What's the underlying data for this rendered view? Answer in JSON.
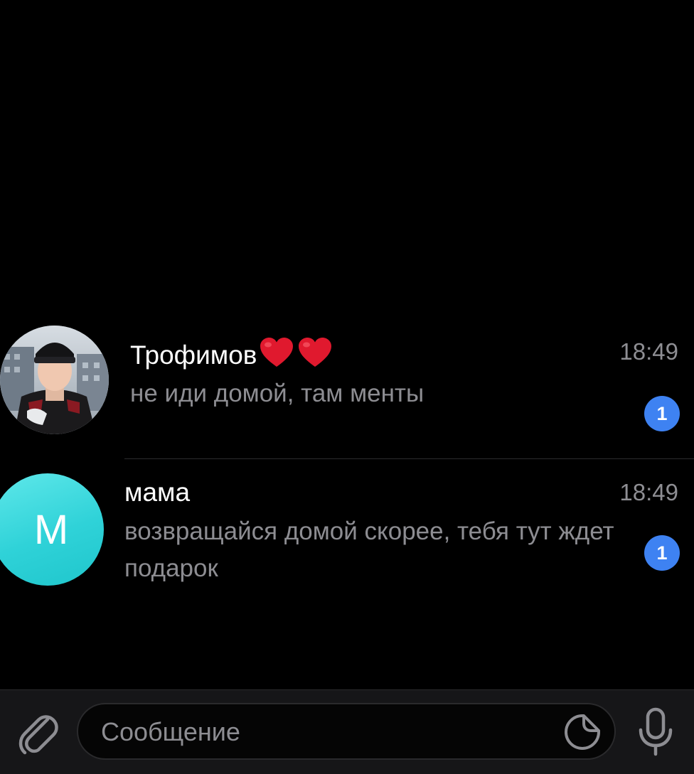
{
  "chats": [
    {
      "name": "Трофимов",
      "name_emoji": "❤️❤️",
      "time": "18:49",
      "preview": "не иди домой, там менты",
      "unread_count": "1",
      "avatar": "photo"
    },
    {
      "name": "мама",
      "time": "18:49",
      "preview": "возвращайся домой скорее, тебя тут ждет подарок",
      "unread_count": "1",
      "avatar_letter": "М"
    }
  ],
  "composer": {
    "placeholder": "Сообщение",
    "attach_icon": "paperclip-icon",
    "sticker_icon": "sticker-icon",
    "mic_icon": "microphone-icon"
  },
  "colors": {
    "background": "#000000",
    "badge": "#3e82f2",
    "avatar_cyan": "#2fd2d8",
    "secondary_text": "#8d8d92",
    "heart": "#e0192e"
  }
}
